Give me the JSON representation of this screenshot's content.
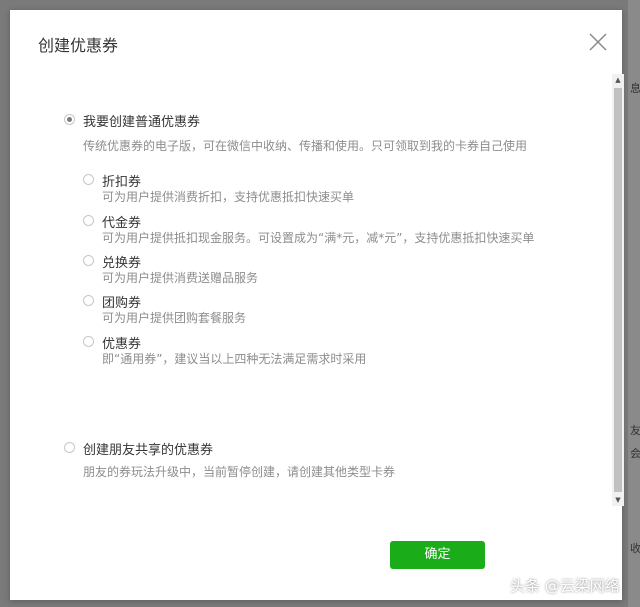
{
  "dialog": {
    "title": "创建优惠券",
    "confirm_label": "确定"
  },
  "options": {
    "normal": {
      "label": "我要创建普通优惠券",
      "desc": "传统优惠券的电子版，可在微信中收纳、传播和使用。只可领取到我的卡券自己使用",
      "selected": true,
      "sub_options": [
        {
          "label": "折扣券",
          "desc": "可为用户提供消费折扣，支持优惠抵扣快速买单"
        },
        {
          "label": "代金券",
          "desc": "可为用户提供抵扣现金服务。可设置成为“满*元，减*元”，支持优惠抵扣快速买单"
        },
        {
          "label": "兑换券",
          "desc": "可为用户提供消费送赠品服务"
        },
        {
          "label": "团购券",
          "desc": "可为用户提供团购套餐服务"
        },
        {
          "label": "优惠券",
          "desc": "即“通用券”，建议当以上四种无法满足需求时采用"
        }
      ]
    },
    "friend": {
      "label": "创建朋友共享的优惠券",
      "desc": "朋友的券玩法升级中，当前暂停创建，请创建其他类型卡券",
      "selected": false
    }
  },
  "background": {
    "glyphs": [
      "息",
      "友",
      "会",
      "收"
    ]
  },
  "watermark": "头条 @云梁网络"
}
